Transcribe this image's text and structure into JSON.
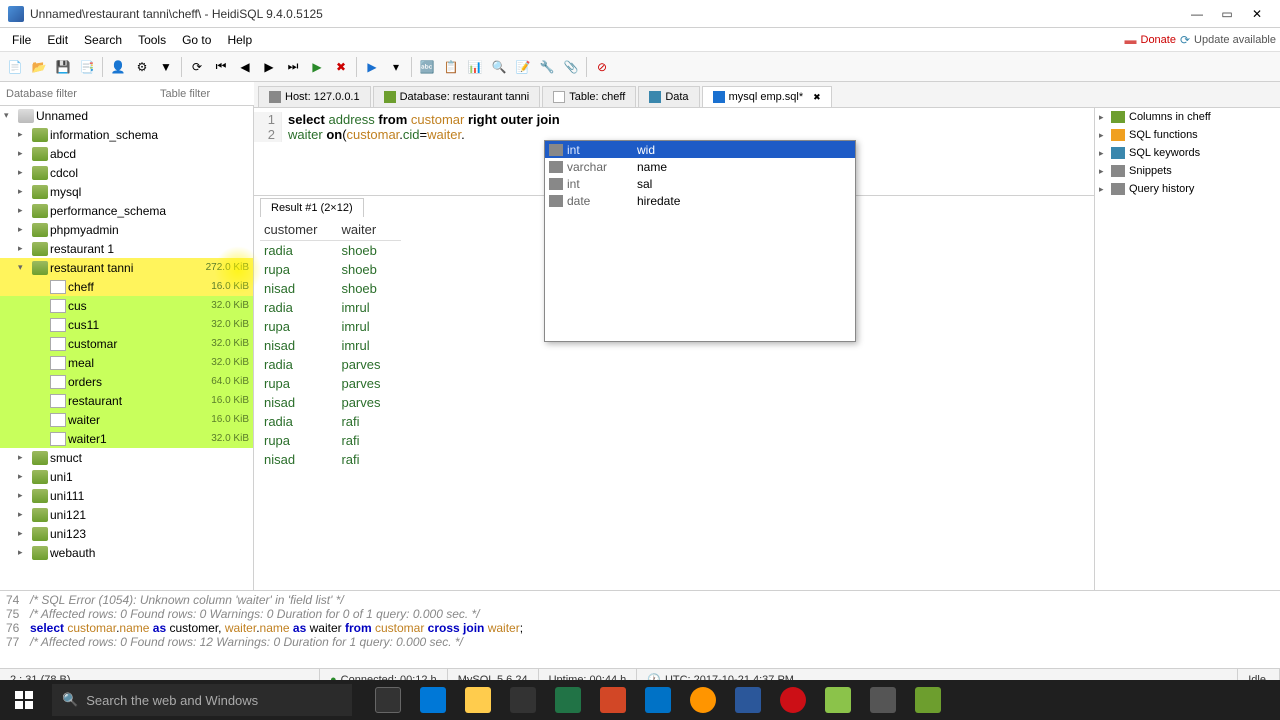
{
  "window": {
    "title": "Unnamed\\restaurant tanni\\cheff\\ - HeidiSQL 9.4.0.5125"
  },
  "menu": {
    "items": [
      "File",
      "Edit",
      "Search",
      "Tools",
      "Go to",
      "Help"
    ],
    "donate": "Donate",
    "update": "Update available"
  },
  "filters": {
    "db_placeholder": "Database filter",
    "table_placeholder": "Table filter"
  },
  "tree": {
    "root": "Unnamed",
    "dbs": [
      {
        "name": "information_schema"
      },
      {
        "name": "abcd"
      },
      {
        "name": "cdcol"
      },
      {
        "name": "mysql"
      },
      {
        "name": "performance_schema"
      },
      {
        "name": "phpmyadmin"
      },
      {
        "name": "restaurant 1"
      },
      {
        "name": "restaurant tanni",
        "size": "272.0 KiB",
        "expanded": true,
        "tables": [
          {
            "name": "cheff",
            "size": "16.0 KiB",
            "selected": true
          },
          {
            "name": "cus",
            "size": "32.0 KiB"
          },
          {
            "name": "cus11",
            "size": "32.0 KiB"
          },
          {
            "name": "customar",
            "size": "32.0 KiB"
          },
          {
            "name": "meal",
            "size": "32.0 KiB"
          },
          {
            "name": "orders",
            "size": "64.0 KiB"
          },
          {
            "name": "restaurant",
            "size": "16.0 KiB"
          },
          {
            "name": "waiter",
            "size": "16.0 KiB"
          },
          {
            "name": "waiter1",
            "size": "32.0 KiB"
          }
        ]
      },
      {
        "name": "smuct"
      },
      {
        "name": "uni1"
      },
      {
        "name": "uni111"
      },
      {
        "name": "uni121"
      },
      {
        "name": "uni123"
      },
      {
        "name": "webauth"
      }
    ]
  },
  "tabs": {
    "host": "Host: 127.0.0.1",
    "database": "Database: restaurant tanni",
    "table": "Table: cheff",
    "data": "Data",
    "query": "mysql emp.sql*"
  },
  "editor": {
    "lines": [
      {
        "n": "1",
        "tokens": [
          {
            "t": "select",
            "c": "kw"
          },
          {
            "t": " "
          },
          {
            "t": "address",
            "c": "col"
          },
          {
            "t": " "
          },
          {
            "t": "from",
            "c": "kw"
          },
          {
            "t": " "
          },
          {
            "t": "customar",
            "c": "tbl"
          },
          {
            "t": " "
          },
          {
            "t": "right outer join",
            "c": "kw"
          }
        ]
      },
      {
        "n": "2",
        "tokens": [
          {
            "t": "waiter",
            "c": "col"
          },
          {
            "t": " "
          },
          {
            "t": "on",
            "c": "kw"
          },
          {
            "t": "("
          },
          {
            "t": "customar",
            "c": "tbl"
          },
          {
            "t": "."
          },
          {
            "t": "cid",
            "c": "col"
          },
          {
            "t": "="
          },
          {
            "t": "waiter",
            "c": "tbl"
          },
          {
            "t": "."
          }
        ]
      }
    ]
  },
  "autocomplete": {
    "items": [
      {
        "type": "int",
        "name": "wid",
        "sel": true
      },
      {
        "type": "varchar",
        "name": "name"
      },
      {
        "type": "int",
        "name": "sal"
      },
      {
        "type": "date",
        "name": "hiredate"
      }
    ]
  },
  "result": {
    "tab": "Result #1 (2×12)",
    "columns": [
      "customer",
      "waiter"
    ],
    "rows": [
      [
        "radia",
        "shoeb"
      ],
      [
        "rupa",
        "shoeb"
      ],
      [
        "nisad",
        "shoeb"
      ],
      [
        "radia",
        "imrul"
      ],
      [
        "rupa",
        "imrul"
      ],
      [
        "nisad",
        "imrul"
      ],
      [
        "radia",
        "parves"
      ],
      [
        "rupa",
        "parves"
      ],
      [
        "nisad",
        "parves"
      ],
      [
        "radia",
        "rafi"
      ],
      [
        "rupa",
        "rafi"
      ],
      [
        "nisad",
        "rafi"
      ]
    ]
  },
  "rightpanel": {
    "items": [
      "Columns in cheff",
      "SQL functions",
      "SQL keywords",
      "Snippets",
      "Query history"
    ]
  },
  "log": {
    "lines": [
      {
        "n": "74",
        "text": "/* SQL Error (1054): Unknown column 'waiter' in 'field list' */",
        "cls": "cmt"
      },
      {
        "n": "75",
        "text": "/* Affected rows: 0  Found rows: 0  Warnings: 0  Duration for 0 of 1 query: 0.000 sec. */",
        "cls": "cmt"
      },
      {
        "n": "76",
        "html": "<span class='kw2'>select</span> <span class='id2'>customar</span>.<span class='id2'>name</span> <span class='kw2'>as</span> customer, <span class='id2'>waiter</span>.<span class='id2'>name</span> <span class='kw2'>as</span> waiter <span class='kw2'>from</span> <span class='id2'>customar</span> <span class='kw2'>cross join</span> <span class='id2'>waiter</span>;"
      },
      {
        "n": "77",
        "text": "/* Affected rows: 0  Found rows: 12  Warnings: 0  Duration for 1 query: 0.000 sec. */",
        "cls": "cmt"
      }
    ]
  },
  "status": {
    "pos": "2 : 31 (78 B)",
    "connected": "Connected: 00:12 h",
    "server": "MySQL 5.6.24",
    "uptime": "Uptime: 00:44 h",
    "clock": "UTC: 2017-10-21 4:37 PM",
    "idle": "Idle."
  },
  "taskbar": {
    "search_placeholder": "Search the web and Windows"
  }
}
